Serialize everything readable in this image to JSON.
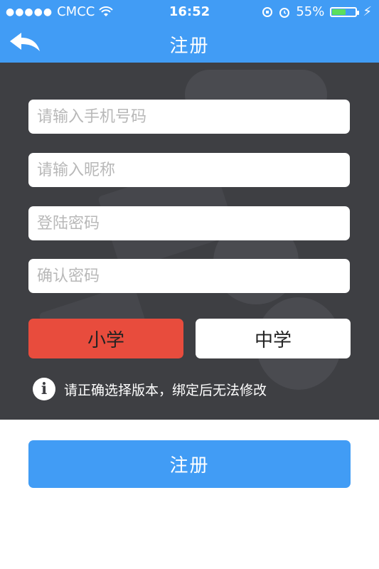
{
  "status_bar": {
    "carrier": "CMCC",
    "time": "16:52",
    "battery_percent": "55%",
    "battery_level": 0.55,
    "signal_icon": "signal-dots-icon",
    "wifi_icon": "wifi-icon",
    "lock_icon": "rotation-lock-icon",
    "alarm_icon": "alarm-icon",
    "charging_icon": "charging-bolt-icon"
  },
  "header": {
    "title": "注册",
    "back_icon": "back-arrow-icon"
  },
  "form": {
    "phone_placeholder": "请输入手机号码",
    "nickname_placeholder": "请输入昵称",
    "password_placeholder": "登陆密码",
    "confirm_placeholder": "确认密码",
    "version_options": [
      "小学",
      "中学"
    ],
    "selected_version": "小学",
    "notice": "请正确选择版本，绑定后无法修改",
    "notice_icon": "info-icon"
  },
  "footer": {
    "register_label": "注册"
  },
  "colors": {
    "primary": "#419cf5",
    "selected": "#e84c3d",
    "background_dark": "#3e3f43"
  }
}
